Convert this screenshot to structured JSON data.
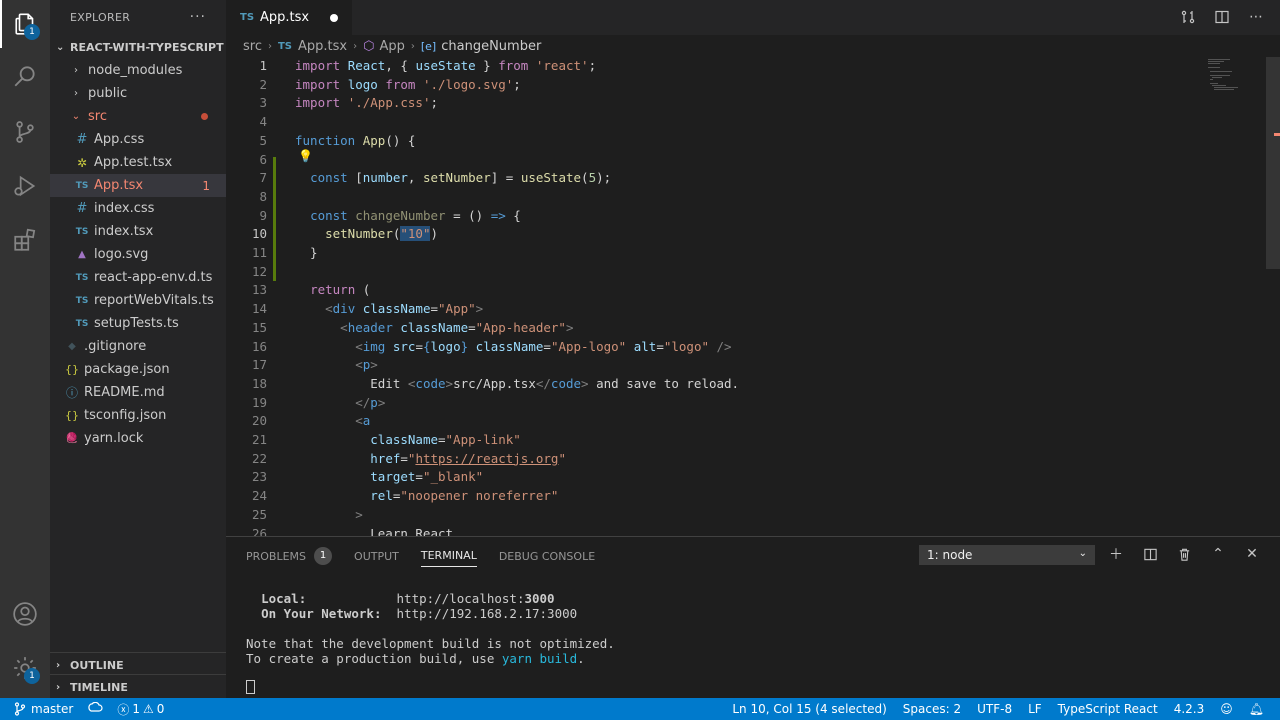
{
  "activitybar": {
    "explorer_badge": "1",
    "settings_badge": "1"
  },
  "sidebar": {
    "title": "EXPLORER",
    "more": "···",
    "project": "REACT-WITH-TYPESCRIPT",
    "items": [
      {
        "label": "node_modules",
        "icon": "›"
      },
      {
        "label": "public",
        "icon": "›"
      },
      {
        "label": "src",
        "icon": "⌄"
      },
      {
        "label": "App.css",
        "icon": "#"
      },
      {
        "label": "App.test.tsx",
        "icon": "✲"
      },
      {
        "label": "App.tsx",
        "icon": "TS",
        "errors": "1"
      },
      {
        "label": "index.css",
        "icon": "#"
      },
      {
        "label": "index.tsx",
        "icon": "TS"
      },
      {
        "label": "logo.svg",
        "icon": "▲"
      },
      {
        "label": "react-app-env.d.ts",
        "icon": "TS"
      },
      {
        "label": "reportWebVitals.ts",
        "icon": "TS"
      },
      {
        "label": "setupTests.ts",
        "icon": "TS"
      },
      {
        "label": ".gitignore",
        "icon": "◆"
      },
      {
        "label": "package.json",
        "icon": "{}"
      },
      {
        "label": "README.md",
        "icon": "ⓘ"
      },
      {
        "label": "tsconfig.json",
        "icon": "{}"
      },
      {
        "label": "yarn.lock",
        "icon": "🧶"
      }
    ],
    "outline": "OUTLINE",
    "timeline": "TIMELINE"
  },
  "tabs": {
    "active_label": "App.tsx",
    "ts_badge": "TS"
  },
  "breadcrumb": {
    "items": [
      "src",
      "App.tsx",
      "App",
      "changeNumber"
    ]
  },
  "editor": {
    "line_numbers": [
      "1",
      "2",
      "3",
      "4",
      "5",
      "6",
      "7",
      "8",
      "9",
      "10",
      "11",
      "12",
      "13",
      "14",
      "15",
      "16",
      "17",
      "18",
      "19",
      "20",
      "21",
      "22",
      "23",
      "24",
      "25",
      "26"
    ],
    "current_line": 10
  },
  "panel": {
    "tabs": [
      "PROBLEMS",
      "OUTPUT",
      "TERMINAL",
      "DEBUG CONSOLE"
    ],
    "problems_count": "1",
    "terminal_select": "1: node",
    "terminal_lines": {
      "local_label": "Local:",
      "local_url_prefix": "http://localhost:",
      "local_port": "3000",
      "network_label": "On Your Network:",
      "network_url": "http://192.168.2.17:3000",
      "note1": "Note that the development build is not optimized.",
      "note2_prefix": "To create a production build, use ",
      "note2_cmd": "yarn build",
      "note2_suffix": "."
    }
  },
  "statusbar": {
    "branch": "master",
    "errors": "1",
    "warnings": "0",
    "position": "Ln 10, Col 15 (4 selected)",
    "spaces": "Spaces: 2",
    "encoding": "UTF-8",
    "eol": "LF",
    "language": "TypeScript React",
    "version": "4.2.3"
  }
}
